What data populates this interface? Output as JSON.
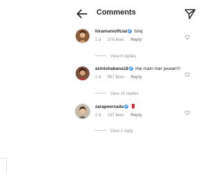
{
  "header": {
    "title": "Comments"
  },
  "comments": [
    {
      "username": "hiramanioffcial",
      "verified": true,
      "text": "Ishq",
      "time": "1 d",
      "likes": "376 likes",
      "reply_label": "Reply",
      "view_replies": "View 6 replies"
    },
    {
      "username": "azmishabana18",
      "verified": true,
      "text": "Hai main mar javaan!!!",
      "time": "1 d",
      "likes": "567 likes",
      "reply_label": "Reply",
      "view_replies": "View 10 replies"
    },
    {
      "username": "zarapeerzada",
      "verified": true,
      "text": "",
      "emoji": "heart-emoji",
      "time": "1 d",
      "likes": "167 likes",
      "reply_label": "Reply",
      "view_replies": "View 1 reply"
    }
  ],
  "colors": {
    "text": "#262626",
    "muted": "#8e8e8e",
    "verified_blue": "#3897f0",
    "emoji_red": "#d42a3a"
  }
}
